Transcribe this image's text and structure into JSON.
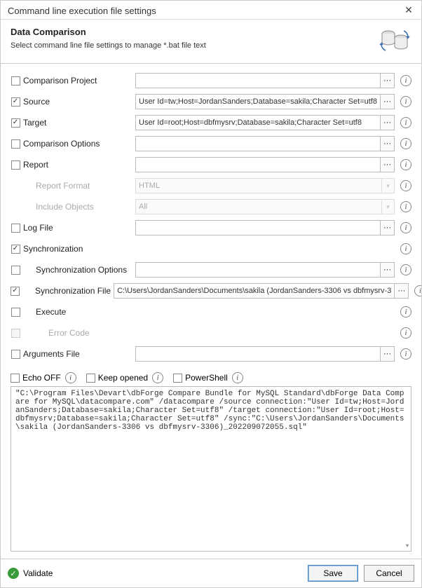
{
  "title": "Command line execution file settings",
  "header": {
    "title": "Data Comparison",
    "subtitle": "Select command line file settings to manage *.bat file text"
  },
  "icons": {
    "dots": "···",
    "chevron_down": "▼",
    "info": "i",
    "check": "✓",
    "close": "✕"
  },
  "rows": {
    "comparison_project": {
      "label": "Comparison Project",
      "checked": false,
      "value": "",
      "has_dots": true
    },
    "source": {
      "label": "Source",
      "checked": true,
      "value": "User Id=tw;Host=JordanSanders;Database=sakila;Character Set=utf8",
      "has_dots": true
    },
    "target": {
      "label": "Target",
      "checked": true,
      "value": "User Id=root;Host=dbfmysrv;Database=sakila;Character Set=utf8",
      "has_dots": true
    },
    "comparison_options": {
      "label": "Comparison Options",
      "checked": false,
      "value": "",
      "has_dots": true
    },
    "report": {
      "label": "Report",
      "checked": false,
      "value": "",
      "has_dots": true
    },
    "report_format": {
      "label": "Report Format",
      "value": "HTML",
      "disabled": true,
      "dropdown": true
    },
    "include_objects": {
      "label": "Include Objects",
      "value": "All",
      "disabled": true,
      "dropdown": true
    },
    "log_file": {
      "label": "Log File",
      "checked": false,
      "value": "",
      "has_dots": true
    },
    "synchronization": {
      "label": "Synchronization",
      "checked": true
    },
    "sync_options": {
      "label": "Synchronization Options",
      "checked": false,
      "value": "",
      "has_dots": true
    },
    "sync_file": {
      "label": "Synchronization File",
      "checked": true,
      "value": "C:\\Users\\JordanSanders\\Documents\\sakila (JordanSanders-3306 vs dbfmysrv-3",
      "has_dots": true
    },
    "execute": {
      "label": "Execute",
      "checked": false
    },
    "error_code": {
      "label": "Error Code",
      "disabled": true
    },
    "arguments_file": {
      "label": "Arguments File",
      "checked": false,
      "value": "",
      "has_dots": true
    }
  },
  "options": {
    "echo_off": {
      "label": "Echo OFF",
      "checked": false
    },
    "keep_opened": {
      "label": "Keep opened",
      "checked": false
    },
    "powershell": {
      "label": "PowerShell",
      "checked": false
    }
  },
  "command_text": "\"C:\\Program Files\\Devart\\dbForge Compare Bundle for MySQL Standard\\dbForge Data Compare for MySQL\\datacompare.com\" /datacompare /source connection:\"User Id=tw;Host=JordanSanders;Database=sakila;Character Set=utf8\" /target connection:\"User Id=root;Host=dbfmysrv;Database=sakila;Character Set=utf8\" /sync:\"C:\\Users\\JordanSanders\\Documents\\sakila (JordanSanders-3306 vs dbfmysrv-3306)_202209072055.sql\"",
  "footer": {
    "validate": "Validate",
    "save": "Save",
    "cancel": "Cancel"
  },
  "colors": {
    "accent": "#4a88c7",
    "success": "#3a9b3a"
  }
}
